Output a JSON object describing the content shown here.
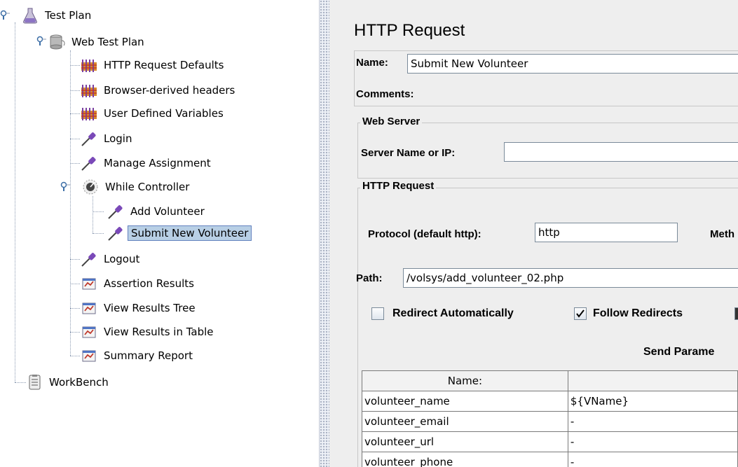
{
  "tree": {
    "items": [
      {
        "label": "Test Plan"
      },
      {
        "label": "Web Test Plan"
      },
      {
        "label": "HTTP Request Defaults"
      },
      {
        "label": "Browser-derived headers"
      },
      {
        "label": "User Defined Variables"
      },
      {
        "label": "Login"
      },
      {
        "label": "Manage Assignment"
      },
      {
        "label": "While Controller"
      },
      {
        "label": "Add Volunteer"
      },
      {
        "label": "Submit New Volunteer"
      },
      {
        "label": "Logout"
      },
      {
        "label": "Assertion Results"
      },
      {
        "label": "View Results Tree"
      },
      {
        "label": "View Results in Table"
      },
      {
        "label": "Summary Report"
      },
      {
        "label": "WorkBench"
      }
    ],
    "selected": "Submit New Volunteer"
  },
  "panel": {
    "title": "HTTP Request",
    "name_label": "Name:",
    "name_value": "Submit New Volunteer",
    "comments_label": "Comments:",
    "web_server": {
      "legend": "Web Server",
      "server_label": "Server Name or IP:",
      "server_value": ""
    },
    "http_request": {
      "legend": "HTTP Request",
      "protocol_label": "Protocol (default http):",
      "protocol_value": "http",
      "method_label": "Meth",
      "path_label": "Path:",
      "path_value": "/volsys/add_volunteer_02.php",
      "redirect_auto_label": "Redirect Automatically",
      "redirect_auto_checked": false,
      "follow_redirects_label": "Follow Redirects",
      "follow_redirects_checked": true,
      "send_params_label": "Send Parame"
    },
    "params_table": {
      "headers": [
        "Name:",
        ""
      ],
      "rows": [
        [
          "volunteer_name",
          "${VName}"
        ],
        [
          "volunteer_email",
          "-"
        ],
        [
          "volunteer_url",
          "-"
        ],
        [
          "volunteer_phone",
          "-"
        ]
      ]
    }
  }
}
